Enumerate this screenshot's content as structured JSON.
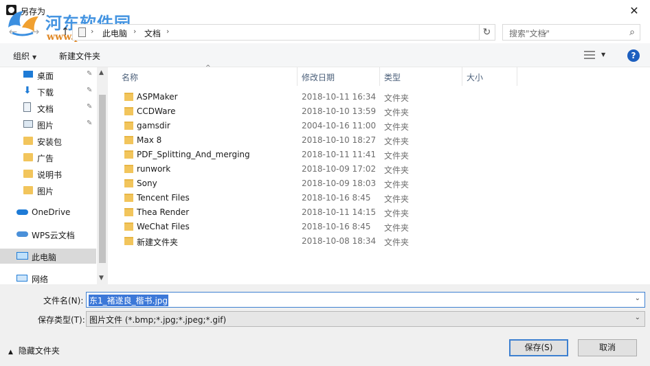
{
  "window": {
    "title": "另存为",
    "close_glyph": "✕"
  },
  "watermark": {
    "title": "河东软件园",
    "url": "www.pc0359.cn"
  },
  "nav": {
    "back_glyph": "←",
    "forward_glyph": "→",
    "up_glyph": "↑",
    "breadcrumb": [
      "此电脑",
      "文档"
    ],
    "separator": "›",
    "search_placeholder": "搜索\"文档\"",
    "refresh_glyph": "↻",
    "search_glyph": "⌕",
    "dropdown_glyph": "⌄"
  },
  "toolbar": {
    "organize": "组织",
    "new_folder": "新建文件夹",
    "help": "?"
  },
  "sidebar": {
    "quick_access": [
      {
        "label": "桌面",
        "icon": "desktop-icon",
        "pinned": true
      },
      {
        "label": "下载",
        "icon": "download-icon",
        "pinned": true
      },
      {
        "label": "文档",
        "icon": "document-icon",
        "pinned": true
      },
      {
        "label": "图片",
        "icon": "picture-icon",
        "pinned": true
      },
      {
        "label": "安装包",
        "icon": "folder-icon",
        "pinned": false
      },
      {
        "label": "广告",
        "icon": "folder-icon",
        "pinned": false
      },
      {
        "label": "说明书",
        "icon": "folder-icon",
        "pinned": false
      },
      {
        "label": "图片",
        "icon": "folder-icon",
        "pinned": false
      }
    ],
    "onedrive": "OneDrive",
    "wps": "WPS云文档",
    "this_pc": "此电脑",
    "network": "网络",
    "pin_glyph": "📌"
  },
  "columns": {
    "name": "名称",
    "date": "修改日期",
    "type": "类型",
    "size": "大小"
  },
  "files": [
    {
      "name": "ASPMaker",
      "date": "2018-10-11 16:34",
      "type": "文件夹"
    },
    {
      "name": "CCDWare",
      "date": "2018-10-10 13:59",
      "type": "文件夹"
    },
    {
      "name": "gamsdir",
      "date": "2004-10-16 11:00",
      "type": "文件夹"
    },
    {
      "name": "Max 8",
      "date": "2018-10-10 18:27",
      "type": "文件夹"
    },
    {
      "name": "PDF_Splitting_And_merging",
      "date": "2018-10-11 11:41",
      "type": "文件夹"
    },
    {
      "name": "runwork",
      "date": "2018-10-09 17:02",
      "type": "文件夹"
    },
    {
      "name": "Sony",
      "date": "2018-10-09 18:03",
      "type": "文件夹"
    },
    {
      "name": "Tencent Files",
      "date": "2018-10-16 8:45",
      "type": "文件夹"
    },
    {
      "name": "Thea Render",
      "date": "2018-10-11 14:15",
      "type": "文件夹"
    },
    {
      "name": "WeChat Files",
      "date": "2018-10-16 8:45",
      "type": "文件夹"
    },
    {
      "name": "新建文件夹",
      "date": "2018-10-08 18:34",
      "type": "文件夹"
    }
  ],
  "save": {
    "filename_label": "文件名(N):",
    "filename_value": "东1_褚遂良_楷书.jpg",
    "filetype_label": "保存类型(T):",
    "filetype_value": "图片文件 (*.bmp;*.jpg;*.jpeg;*.gif)",
    "hide_folders": "隐藏文件夹",
    "save_button": "保存(S)",
    "cancel_button": "取消"
  },
  "colors": {
    "accent": "#3c7fd0",
    "folder": "#f2c55c",
    "help": "#1d5fbf",
    "selection": "#3c78d8"
  }
}
